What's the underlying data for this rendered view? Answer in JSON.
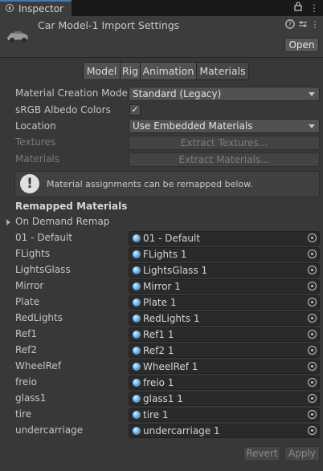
{
  "tab": {
    "label": "Inspector"
  },
  "header": {
    "title": "Car Model-1 Import Settings",
    "open_label": "Open"
  },
  "toolbar_tabs": [
    "Model",
    "Rig",
    "Animation",
    "Materials"
  ],
  "settings": {
    "material_creation_mode": {
      "label": "Material Creation Mode",
      "value": "Standard (Legacy)"
    },
    "srgb_albedo": {
      "label": "sRGB Albedo Colors",
      "checked": "✓"
    },
    "location": {
      "label": "Location",
      "value": "Use Embedded Materials"
    },
    "textures": {
      "label": "Textures",
      "button": "Extract Textures..."
    },
    "materials": {
      "label": "Materials",
      "button": "Extract Materials..."
    }
  },
  "help_message": "Material assignments can be remapped below.",
  "remapped": {
    "heading": "Remapped Materials",
    "on_demand": "On Demand Remap",
    "rows": [
      {
        "label": "01 - Default",
        "value": "01 - Default"
      },
      {
        "label": "FLights",
        "value": "FLights 1"
      },
      {
        "label": "LightsGlass",
        "value": "LightsGlass 1"
      },
      {
        "label": "Mirror",
        "value": "Mirror 1"
      },
      {
        "label": "Plate",
        "value": "Plate 1"
      },
      {
        "label": "RedLights",
        "value": "RedLights 1"
      },
      {
        "label": "Ref1",
        "value": "Ref1 1"
      },
      {
        "label": "Ref2",
        "value": "Ref2 1"
      },
      {
        "label": "WheelRef",
        "value": "WheelRef 1"
      },
      {
        "label": "freio",
        "value": "freio 1"
      },
      {
        "label": "glass1",
        "value": "glass1 1"
      },
      {
        "label": "tire",
        "value": "tire 1"
      },
      {
        "label": "undercarriage",
        "value": "undercarriage 1"
      }
    ]
  },
  "footer": {
    "revert": "Revert",
    "apply": "Apply"
  }
}
